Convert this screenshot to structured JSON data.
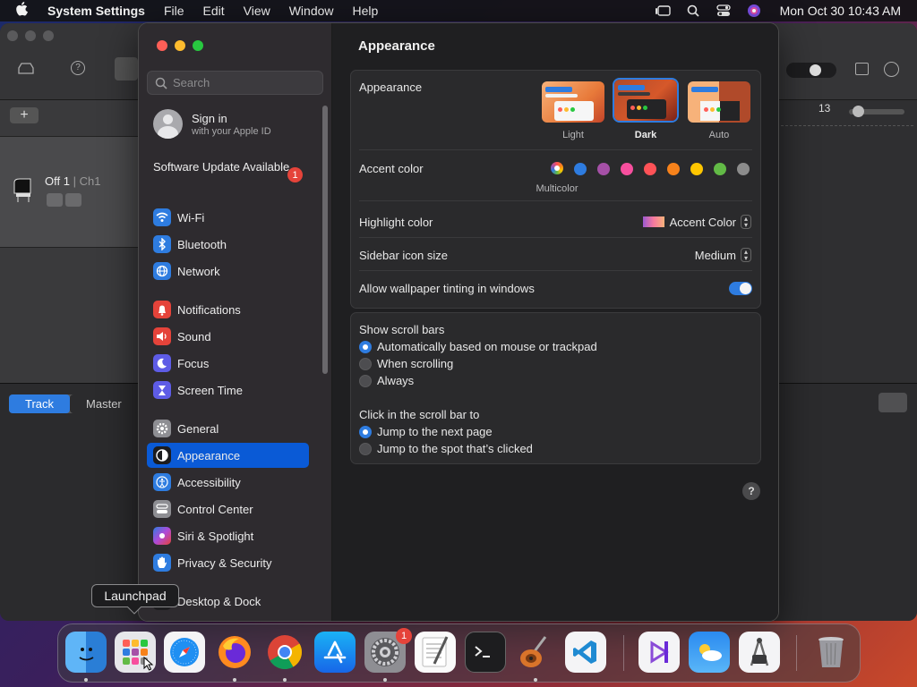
{
  "menubar": {
    "app": "System Settings",
    "items": [
      "File",
      "Edit",
      "View",
      "Window",
      "Help"
    ],
    "clock": "Mon Oct 30  10:43 AM"
  },
  "background_window": {
    "track_name": "Off 1",
    "track_channel": "Ch1",
    "tabs": [
      "Track",
      "Master"
    ],
    "ruler_number": "13"
  },
  "sidebar": {
    "search_placeholder": "Search",
    "signin_title": "Sign in",
    "signin_subtitle": "with your Apple ID",
    "software_update": "Software Update Available",
    "software_update_badge": "1",
    "items": [
      {
        "label": "Wi-Fi",
        "icon": "wifi-icon",
        "color": "#2e7ce0"
      },
      {
        "label": "Bluetooth",
        "icon": "bluetooth-icon",
        "color": "#2e7ce0"
      },
      {
        "label": "Network",
        "icon": "network-icon",
        "color": "#2e7ce0"
      },
      {
        "label": "Notifications",
        "icon": "bell-icon",
        "color": "#e5433a"
      },
      {
        "label": "Sound",
        "icon": "speaker-icon",
        "color": "#e5433a"
      },
      {
        "label": "Focus",
        "icon": "moon-icon",
        "color": "#5e5ce6"
      },
      {
        "label": "Screen Time",
        "icon": "hourglass-icon",
        "color": "#5e5ce6"
      },
      {
        "label": "General",
        "icon": "gear-icon",
        "color": "#8e8e93"
      },
      {
        "label": "Appearance",
        "icon": "appearance-icon",
        "color": "#1c1c1e"
      },
      {
        "label": "Accessibility",
        "icon": "accessibility-icon",
        "color": "#2e7ce0"
      },
      {
        "label": "Control Center",
        "icon": "control-center-icon",
        "color": "#8e8e93"
      },
      {
        "label": "Siri & Spotlight",
        "icon": "siri-icon",
        "color": "#b04ad8"
      },
      {
        "label": "Privacy & Security",
        "icon": "hand-icon",
        "color": "#2e7ce0"
      },
      {
        "label": "Desktop & Dock",
        "icon": "dock-icon",
        "color": "#1c1c1e"
      }
    ],
    "selected": "Appearance"
  },
  "content": {
    "title": "Appearance",
    "appearance_label": "Appearance",
    "appearance_options": [
      "Light",
      "Dark",
      "Auto"
    ],
    "appearance_selected": "Dark",
    "accent_label": "Accent color",
    "accent_caption": "Multicolor",
    "accent_colors": [
      "#9b59d0",
      "#2e7ce0",
      "#a550a7",
      "#f74f9e",
      "#ff5257",
      "#f7821b",
      "#ffc600",
      "#62ba46",
      "#8c8c8c"
    ],
    "highlight_label": "Highlight color",
    "highlight_value": "Accent Color",
    "sidebar_icon_label": "Sidebar icon size",
    "sidebar_icon_value": "Medium",
    "tinting_label": "Allow wallpaper tinting in windows",
    "tinting_on": true,
    "scroll_title": "Show scroll bars",
    "scroll_options": [
      "Automatically based on mouse or trackpad",
      "When scrolling",
      "Always"
    ],
    "click_title": "Click in the scroll bar to",
    "click_options": [
      "Jump to the next page",
      "Jump to the spot that’s clicked"
    ],
    "help": "?"
  },
  "tooltip": "Launchpad",
  "dock": {
    "apps": [
      "finder-icon",
      "launchpad-icon",
      "safari-icon",
      "firefox-icon",
      "chrome-icon",
      "app-store-icon",
      "system-settings-icon",
      "textedit-icon",
      "terminal-icon",
      "garageband-icon",
      "vscode-icon",
      "visual-studio-icon",
      "weather-icon",
      "instruments-icon",
      "trash-icon"
    ],
    "settings_badge": "1"
  }
}
